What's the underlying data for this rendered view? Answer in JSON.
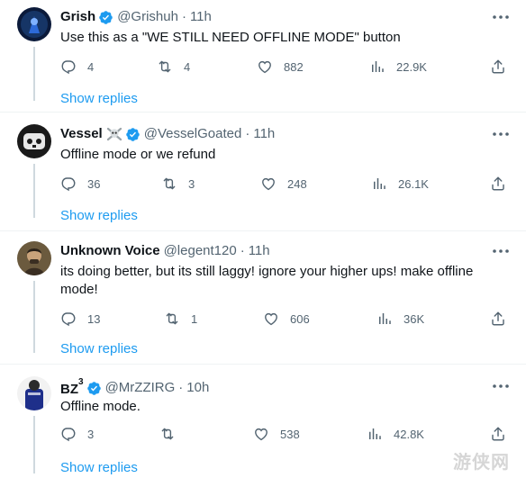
{
  "tweets": [
    {
      "name": "Grish",
      "name_sup": "",
      "handle": "@Grishuh",
      "time": "11h",
      "text": "Use this as a \"WE STILL NEED OFFLINE MODE\" button",
      "replies": "4",
      "reposts": "4",
      "likes": "882",
      "views": "22.9K",
      "verified": true,
      "show_replies": "Show replies"
    },
    {
      "name": "Vessel",
      "name_sup": "",
      "emoji": "skull-and-crossbones",
      "handle": "@VesselGoated",
      "time": "11h",
      "text": "Offline mode or we refund",
      "replies": "36",
      "reposts": "3",
      "likes": "248",
      "views": "26.1K",
      "verified": true,
      "show_replies": "Show replies"
    },
    {
      "name": "Unknown Voice",
      "name_sup": "",
      "handle": "@legent120",
      "time": "11h",
      "text": "its doing better, but its still laggy! ignore your higher ups! make offline mode!",
      "replies": "13",
      "reposts": "1",
      "likes": "606",
      "views": "36K",
      "verified": false,
      "show_replies": "Show replies"
    },
    {
      "name": "BZ",
      "name_sup": "3",
      "handle": "@MrZZIRG",
      "time": "10h",
      "text": "Offline mode.",
      "replies": "3",
      "reposts": "",
      "likes": "538",
      "views": "42.8K",
      "verified": true,
      "show_replies": "Show replies"
    }
  ],
  "separator": "·",
  "watermark": "游侠网",
  "colors": {
    "text": "#0f1419",
    "muted": "#536471",
    "link": "#1d9bf0",
    "verified": "#1d9bf0",
    "divider": "#eff3f4",
    "thread_line": "#cfd9de"
  }
}
